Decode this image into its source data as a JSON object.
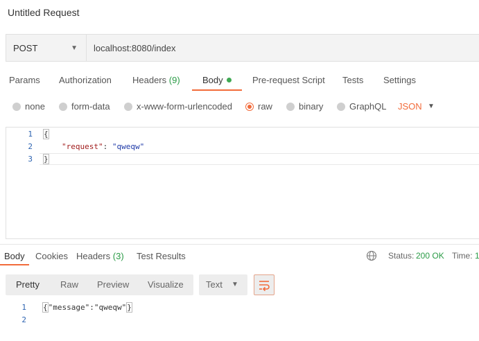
{
  "window": {
    "title": "Untitled Request"
  },
  "request": {
    "method": "POST",
    "url": "localhost:8080/index"
  },
  "request_tabs": [
    {
      "label": "Params"
    },
    {
      "label": "Authorization"
    },
    {
      "label": "Headers",
      "count": "(9)"
    },
    {
      "label": "Body",
      "active": true
    },
    {
      "label": "Pre-request Script"
    },
    {
      "label": "Tests"
    },
    {
      "label": "Settings"
    }
  ],
  "body_types": [
    {
      "label": "none"
    },
    {
      "label": "form-data"
    },
    {
      "label": "x-www-form-urlencoded"
    },
    {
      "label": "raw",
      "selected": true
    },
    {
      "label": "binary"
    },
    {
      "label": "GraphQL"
    }
  ],
  "raw_format": "JSON",
  "request_body": {
    "line_numbers": [
      "1",
      "2",
      "3"
    ],
    "open_brace": "{",
    "key": "\"request\"",
    "colon": ": ",
    "value": "\"qweqw\"",
    "close_brace": "}"
  },
  "response_tabs": [
    {
      "label": "Body",
      "active": true
    },
    {
      "label": "Cookies"
    },
    {
      "label": "Headers",
      "count": "(3)"
    },
    {
      "label": "Test Results"
    }
  ],
  "response_meta": {
    "status_label": "Status:",
    "status_value": "200 OK",
    "time_label": "Time:",
    "time_value": "1"
  },
  "view_modes": [
    "Pretty",
    "Raw",
    "Preview",
    "Visualize"
  ],
  "response_format": "Text",
  "response_body": {
    "line_numbers": [
      "1",
      "2"
    ],
    "open_brace": "{",
    "content": "\"message\":\"qweqw\"",
    "close_brace": "}"
  },
  "colors": {
    "accent": "#f26b3a",
    "success": "#2a9b46",
    "line_number": "#2b62b0"
  }
}
